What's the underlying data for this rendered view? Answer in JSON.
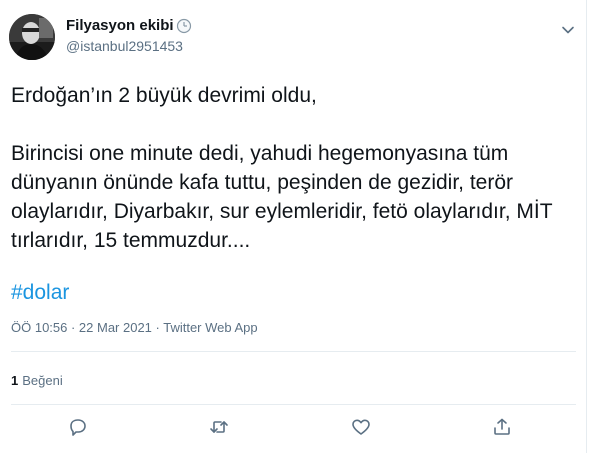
{
  "author": {
    "name": "Filyasyon ekibi",
    "handle": "@istanbul2951453"
  },
  "tweet": {
    "text": "Erdoğan’ın 2 büyük devrimi oldu,\n\nBirincisi one minute dedi, yahudi hegemonyasına tüm dünyanın önünde kafa tuttu, peşinden de gezidir, terör olaylarıdır, Diyarbakır, sur eylemleridir, fetö olaylarıdır, MİT tırlarıdır, 15 temmuzdur....",
    "hashtag": "#dolar",
    "meta": "ÖÖ 10:56 · 22 Mar 2021 · Twitter Web App"
  },
  "stats": {
    "like_count": "1",
    "like_label": "Beğeni"
  },
  "icons": {
    "verified_like": "clock-icon",
    "more": "chevron-down-icon",
    "reply": "reply-icon",
    "retweet": "retweet-icon",
    "like": "heart-icon",
    "share": "share-icon"
  },
  "colors": {
    "hashtag": "#1b95e0",
    "secondary_text": "#5b7083",
    "divider": "#e6ecf0"
  }
}
